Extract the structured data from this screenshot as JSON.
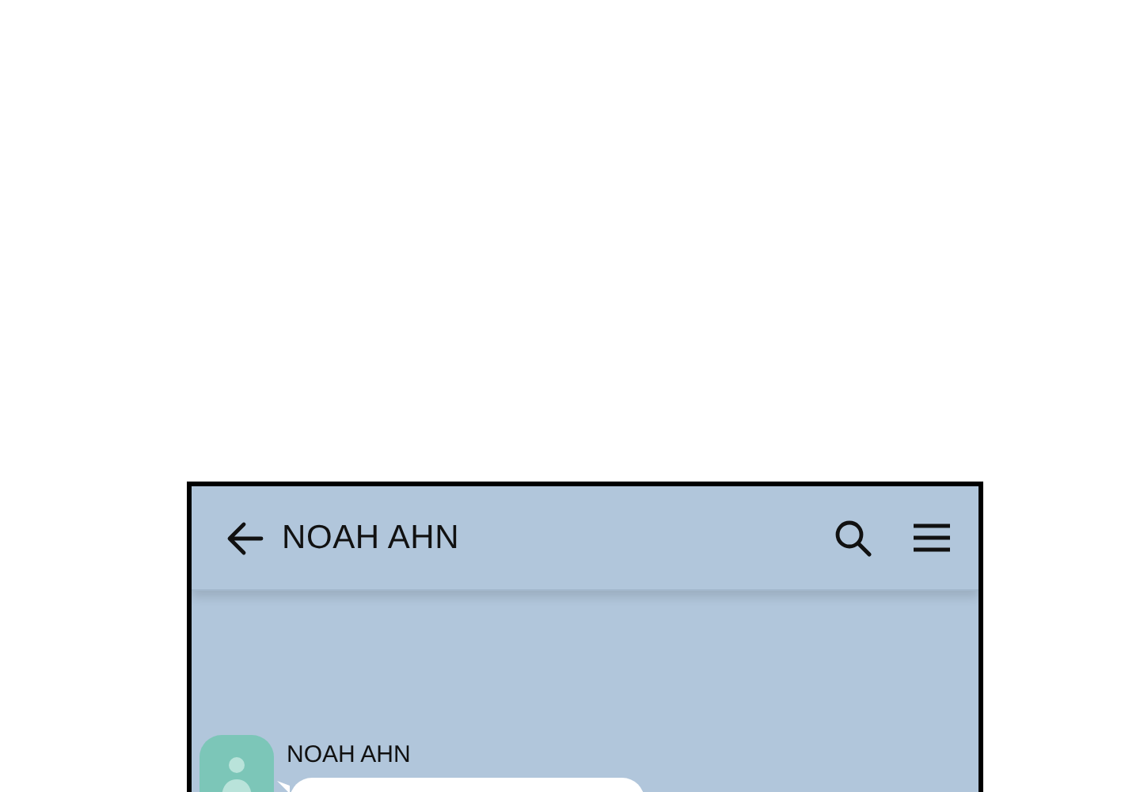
{
  "header": {
    "title": "NOAH AHN"
  },
  "messages": [
    {
      "sender": "NOAH AHN"
    }
  ]
}
